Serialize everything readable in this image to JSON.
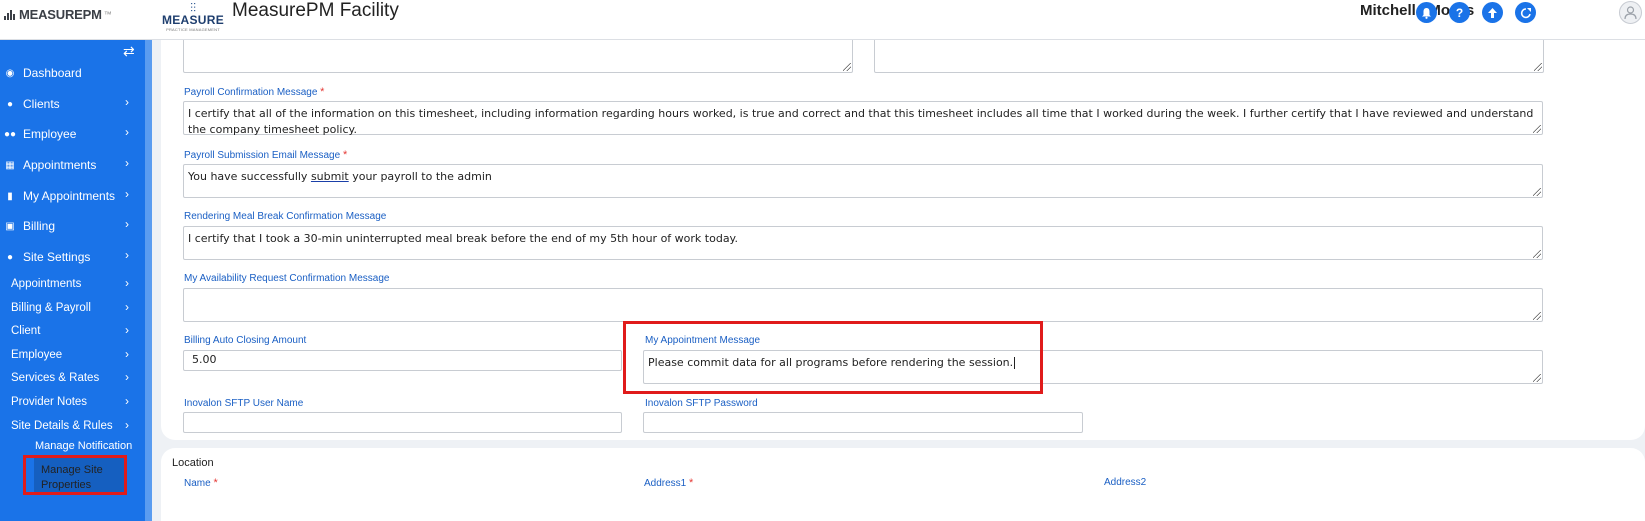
{
  "header": {
    "logo_text": "MEASUREPM",
    "logo_tm": "™",
    "practice_logo_word": "MEASURE",
    "practice_logo_sub": "PRACTICE MANAGEMENT",
    "app_title": "MeasurePM Facility",
    "user_name": "Mitchell , Morris",
    "icons": [
      "bell-icon",
      "help-icon",
      "upload-icon",
      "logout-icon",
      "user-avatar-icon"
    ],
    "accent_color": "#1a73e8"
  },
  "sidebar": {
    "toggle_icon": "⇄",
    "items": [
      {
        "label": "Dashboard",
        "icon": "dashboard-icon"
      },
      {
        "label": "Clients",
        "icon": "user-icon"
      },
      {
        "label": "Employee",
        "icon": "users-icon"
      },
      {
        "label": "Appointments",
        "icon": "calendar-icon"
      },
      {
        "label": "My Appointments",
        "icon": "clipboard-icon"
      },
      {
        "label": "Billing",
        "icon": "money-icon"
      },
      {
        "label": "Site Settings",
        "icon": "user-icon"
      }
    ],
    "sub_items": [
      {
        "label": "Appointments"
      },
      {
        "label": "Billing & Payroll"
      },
      {
        "label": "Client"
      },
      {
        "label": "Employee"
      },
      {
        "label": "Services & Rates"
      },
      {
        "label": "Provider Notes"
      },
      {
        "label": "Site Details & Rules"
      }
    ],
    "subsub_items": [
      {
        "label": "Manage Notification"
      },
      {
        "label": "Manage Site Properties"
      }
    ]
  },
  "form": {
    "payroll_confirmation": {
      "label": "Payroll Confirmation Message",
      "value": "I certify that all of the information on this timesheet, including information regarding hours worked, is true and correct and that this timesheet includes all time that I worked during the week. I further certify that I have reviewed and understand the company timesheet policy."
    },
    "payroll_submission": {
      "label": "Payroll Submission Email Message",
      "value_before": "You have successfully ",
      "value_link": "submit",
      "value_after": " your payroll to the admin"
    },
    "meal_break": {
      "label": "Rendering Meal Break Confirmation Message",
      "value": "I certify that I took a 30-min uninterrupted meal break before the end of my 5th hour of work today."
    },
    "availability": {
      "label": "My Availability Request Confirmation Message",
      "value": ""
    },
    "billing_auto_closing": {
      "label": "Billing Auto Closing Amount",
      "value": "5.00"
    },
    "my_appointment_message": {
      "label": "My Appointment Message",
      "value": "Please commit data for all programs before rendering the session."
    },
    "inovalon_user": {
      "label": "Inovalon SFTP User Name",
      "value": ""
    },
    "inovalon_password": {
      "label": "Inovalon SFTP Password",
      "value": ""
    },
    "required_mark": "*"
  },
  "location": {
    "title": "Location",
    "name_label": "Name",
    "address1_label": "Address1",
    "address2_label": "Address2"
  }
}
